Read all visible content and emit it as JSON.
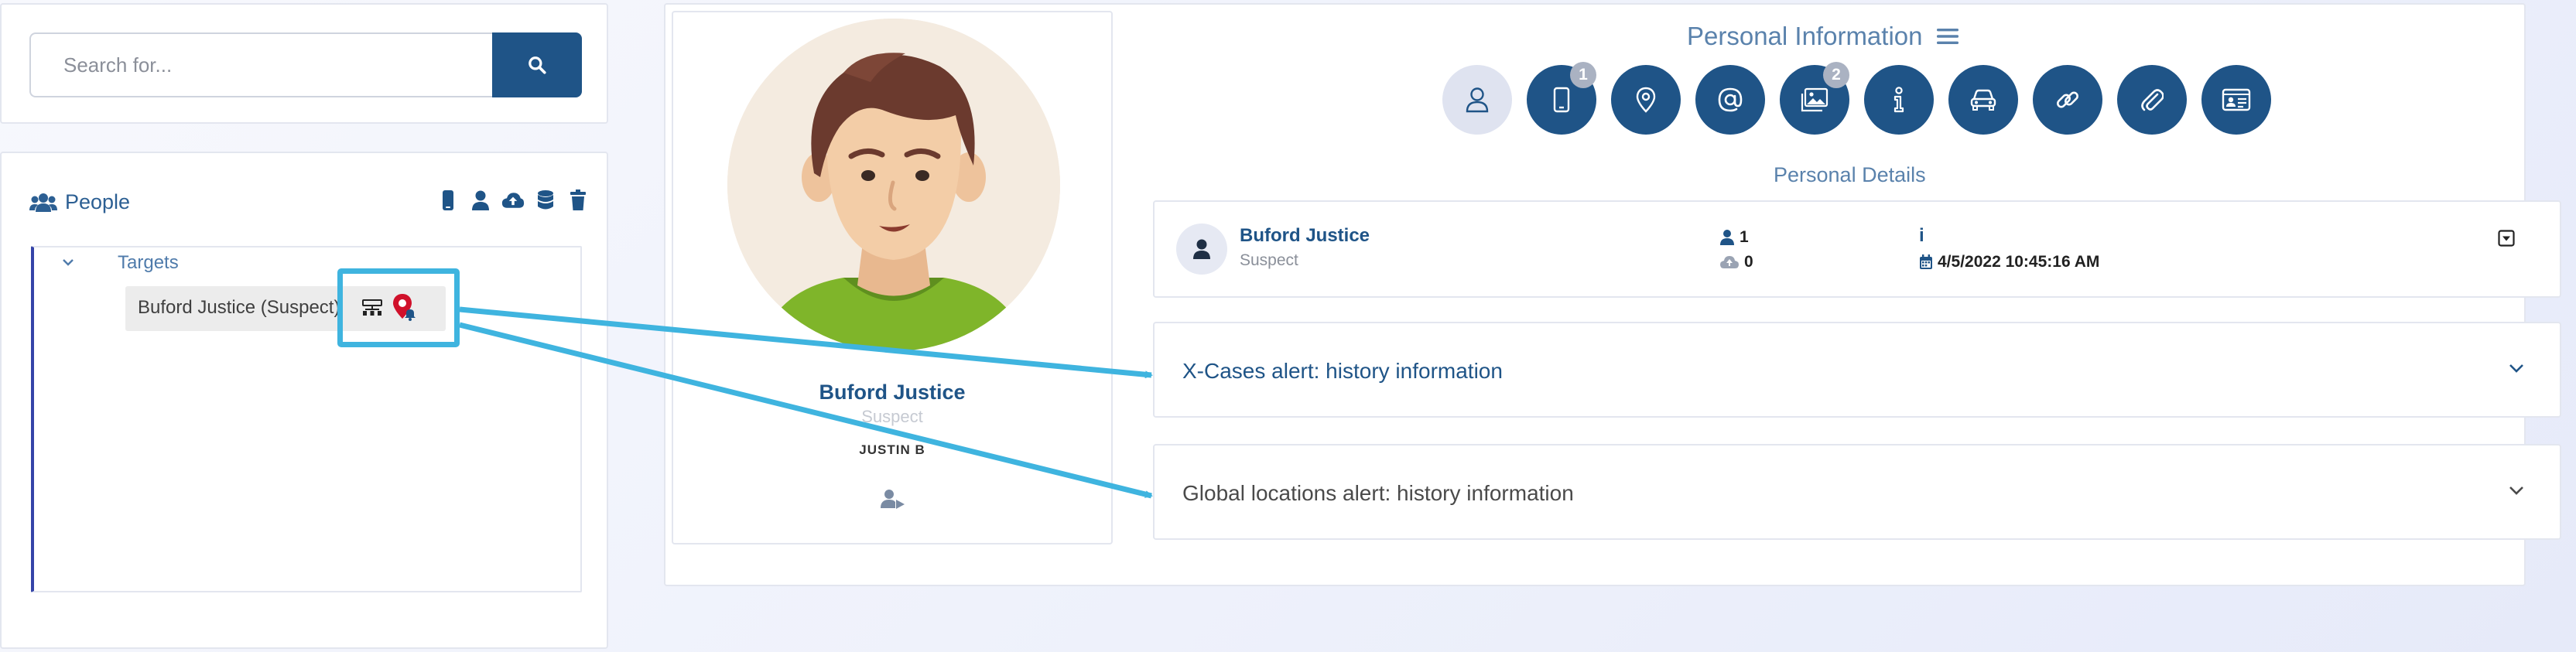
{
  "search": {
    "placeholder": "Search for...",
    "value": ""
  },
  "people": {
    "title": "People",
    "toolbar_icons": [
      "mobile-icon",
      "user-icon",
      "cloud-upload-icon",
      "database-icon",
      "trash-icon"
    ],
    "tree": {
      "group_label": "Targets",
      "node_label": "Buford Justice (Suspect)",
      "node_icons": [
        "network-icon",
        "location-alert-icon"
      ]
    }
  },
  "profile": {
    "name": "Buford Justice",
    "role": "Suspect",
    "username": "JUSTIN B"
  },
  "personal_information": {
    "title": "Personal Information",
    "categories": [
      {
        "icon": "user-icon",
        "badge": "",
        "active": true
      },
      {
        "icon": "mobile-icon",
        "badge": "1",
        "active": false
      },
      {
        "icon": "location-icon",
        "badge": "",
        "active": false
      },
      {
        "icon": "at-icon",
        "badge": "",
        "active": false
      },
      {
        "icon": "images-icon",
        "badge": "2",
        "active": false
      },
      {
        "icon": "info-icon",
        "badge": "",
        "active": false
      },
      {
        "icon": "car-icon",
        "badge": "",
        "active": false
      },
      {
        "icon": "link-icon",
        "badge": "",
        "active": false
      },
      {
        "icon": "paperclip-icon",
        "badge": "",
        "active": false
      },
      {
        "icon": "id-card-icon",
        "badge": "",
        "active": false
      }
    ],
    "details_heading": "Personal Details"
  },
  "details": {
    "name": "Buford Justice",
    "role": "Suspect",
    "persons_count": "1",
    "uploads_count": "0",
    "info_label": "i",
    "date": "4/5/2022 10:45:16 AM"
  },
  "alerts": [
    {
      "title": "X-Cases alert: history information"
    },
    {
      "title": "Global locations alert: history information"
    }
  ],
  "colors": {
    "primary": "#1f5487",
    "accent_highlight": "#3fb4df",
    "marker_red": "#d0112b",
    "heading": "#5a82ac"
  }
}
